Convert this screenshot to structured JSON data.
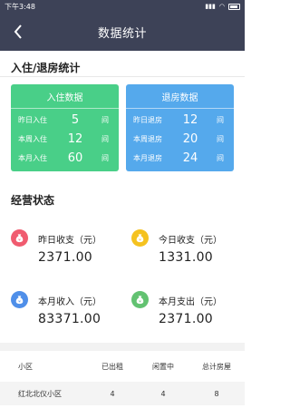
{
  "status_bar": {
    "time": "下午3:48",
    "battery": "battery-icon"
  },
  "nav": {
    "title": "数据统计"
  },
  "checkin_section": {
    "title": "入住/退房统计"
  },
  "checkin_card": {
    "header": "入住数据",
    "color": "#49cf88",
    "rows": [
      {
        "label": "昨日入住",
        "value": "5",
        "unit": "间"
      },
      {
        "label": "本周入住",
        "value": "12",
        "unit": "间"
      },
      {
        "label": "本月入住",
        "value": "60",
        "unit": "间"
      }
    ]
  },
  "checkout_card": {
    "header": "退房数据",
    "color": "#55a9ec",
    "rows": [
      {
        "label": "昨日退房",
        "value": "12",
        "unit": "间"
      },
      {
        "label": "本周退房",
        "value": "20",
        "unit": "间"
      },
      {
        "label": "本月退房",
        "value": "24",
        "unit": "间"
      }
    ]
  },
  "business_section": {
    "title": "经营状态"
  },
  "stats": [
    {
      "label": "昨日收支（元）",
      "value": "2371.00",
      "icon": "money-bag-icon",
      "color": "#f05b6f"
    },
    {
      "label": "今日收支（元）",
      "value": "1331.00",
      "icon": "money-bag-icon",
      "color": "#f5c21f"
    },
    {
      "label": "本月收入（元）",
      "value": "83371.00",
      "icon": "money-bag-icon",
      "color": "#4f8fe9"
    },
    {
      "label": "本月支出（元）",
      "value": "2371.00",
      "icon": "money-bag-icon",
      "color": "#62c271"
    }
  ],
  "table": {
    "headers": [
      "小区",
      "已出租",
      "闲置中",
      "总计房屋"
    ],
    "rows": [
      [
        "红北北仪小区",
        "4",
        "4",
        "8"
      ]
    ]
  }
}
